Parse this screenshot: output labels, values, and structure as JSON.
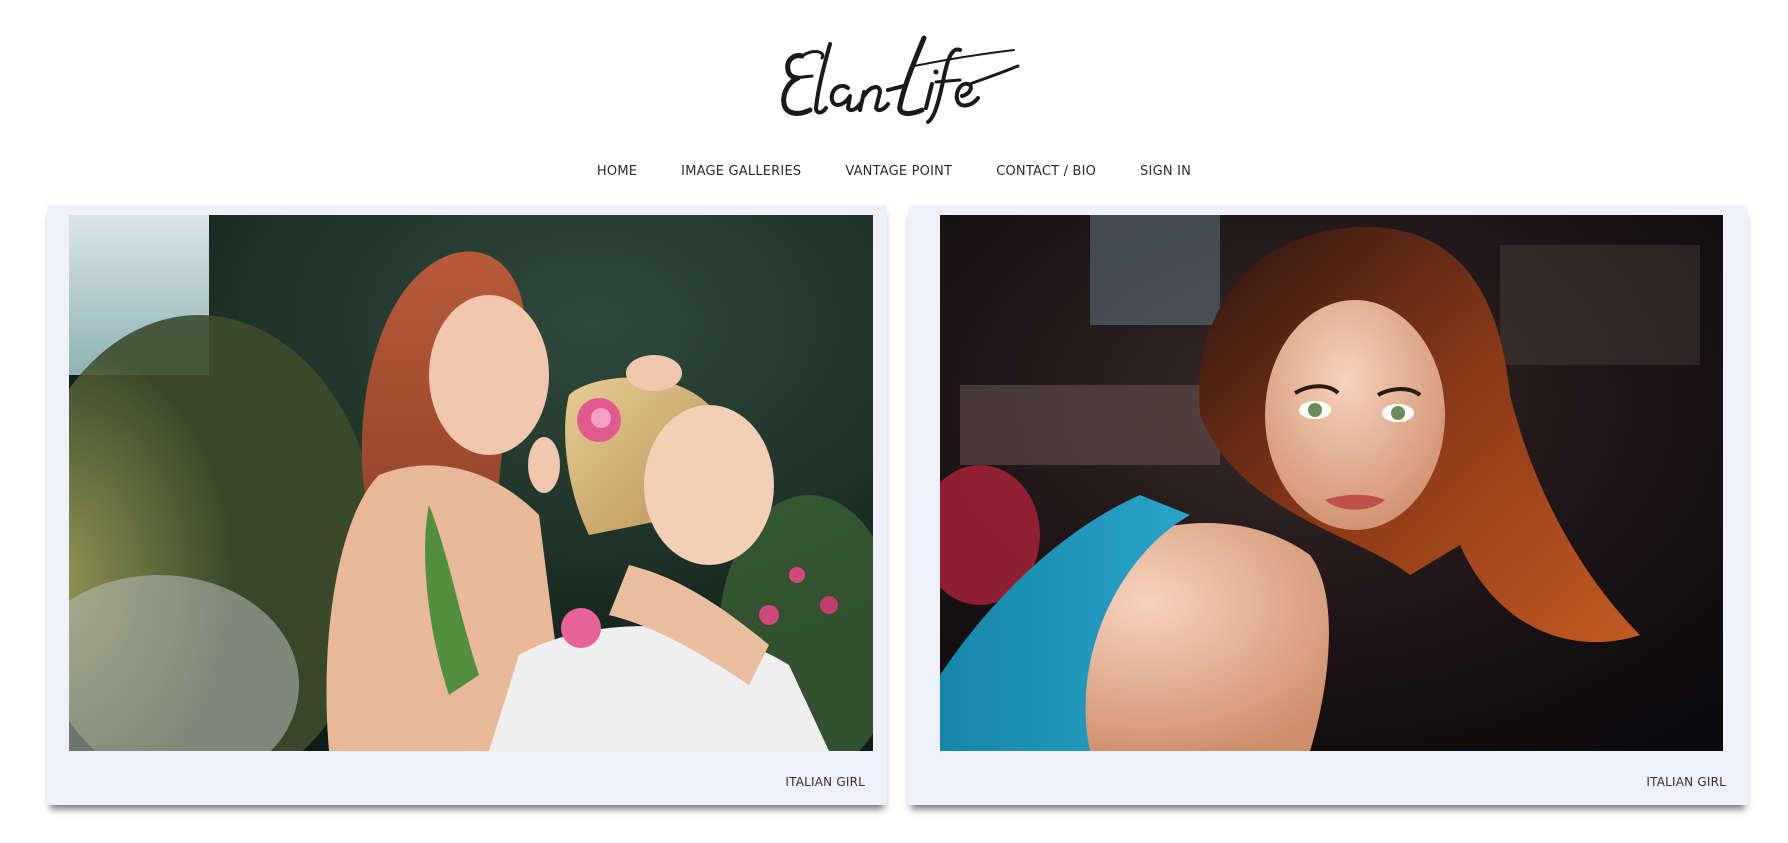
{
  "site": {
    "logo_text": "Elan-Life"
  },
  "nav": {
    "items": [
      {
        "label": "HOME"
      },
      {
        "label": "IMAGE GALLERIES"
      },
      {
        "label": "VANTAGE POINT"
      },
      {
        "label": "CONTACT / BIO"
      },
      {
        "label": "SIGN IN"
      }
    ]
  },
  "gallery": {
    "cards": [
      {
        "caption": "ITALIAN GIRL",
        "image": "two-women-garden-photo"
      },
      {
        "caption": "ITALIAN GIRL",
        "image": "woman-portrait-photo"
      }
    ]
  },
  "colors": {
    "card_background": "#f0f0fb",
    "text": "#2b2b2b"
  }
}
